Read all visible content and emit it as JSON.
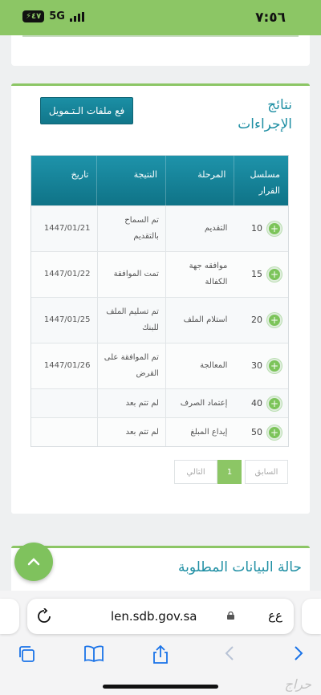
{
  "status": {
    "time": "٧:٥٦",
    "battery": "٤٧",
    "network": "5G"
  },
  "card": {
    "title": "نتائج الإجراءات",
    "fund_button": "فع ملفات الـتـمويل"
  },
  "table": {
    "headers": [
      "مسلسل القرار",
      "المرحلة",
      "النتيجة",
      "تاريخ"
    ],
    "rows": [
      {
        "num": "10",
        "stage": "التقديم",
        "result": "تم السماح بالتقديم",
        "date": "1447/01/21"
      },
      {
        "num": "15",
        "stage": "موافقه جهة الكفالة",
        "result": "تمت الموافقة",
        "date": "1447/01/22"
      },
      {
        "num": "20",
        "stage": "استلام الملف",
        "result": "تم تسليم الملف للبنك",
        "date": "1447/01/25"
      },
      {
        "num": "30",
        "stage": "المعالجة",
        "result": "تم الموافقة على القرض",
        "date": "1447/01/26"
      },
      {
        "num": "40",
        "stage": "إعتماد الصرف",
        "result": "لم تتم بعد",
        "date": ""
      },
      {
        "num": "50",
        "stage": "إيداع المبلغ",
        "result": "لم تتم بعد",
        "date": ""
      }
    ]
  },
  "pagination": {
    "prev": "السابق",
    "current": "1",
    "next": "التالي"
  },
  "card2": {
    "title": "حالة البيانات المطلوبة"
  },
  "browser": {
    "url": "len.sdb.gov.sa",
    "text_size": "ﻉﻉ"
  },
  "watermark": "حراج",
  "colors": {
    "accent_green": "#8cc665",
    "teal": "#1d8ea3"
  }
}
